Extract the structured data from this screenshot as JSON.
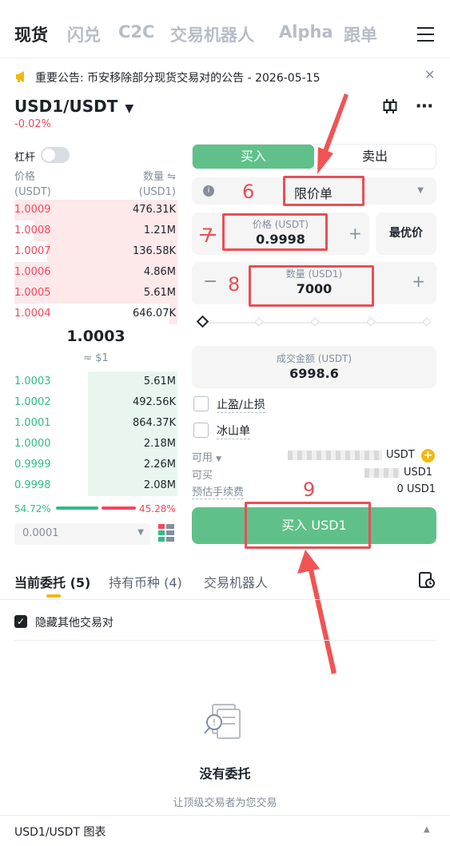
{
  "top_tabs": [
    "现货",
    "闪兑",
    "C2C",
    "交易机器人",
    "Alpha",
    "跟单"
  ],
  "announcement": {
    "text": "重要公告: 币安移除部分现货交易对的公告 - 2026-05-15"
  },
  "pair": {
    "symbol": "USD1/USDT",
    "change": "-0.02%"
  },
  "leverage_label": "杠杆",
  "orderbook": {
    "price_header": "价格",
    "price_unit": "(USDT)",
    "qty_header": "数量",
    "qty_unit": "(USD1)",
    "asks": [
      {
        "price": "1.0009",
        "qty": "476.31K",
        "depth": 1.0
      },
      {
        "price": "1.0008",
        "qty": "1.21M",
        "depth": 0.88
      },
      {
        "price": "1.0007",
        "qty": "136.58K",
        "depth": 0.8
      },
      {
        "price": "1.0006",
        "qty": "4.86M",
        "depth": 1.0
      },
      {
        "price": "1.0005",
        "qty": "5.61M",
        "depth": 1.0
      },
      {
        "price": "1.0004",
        "qty": "646.07K",
        "depth": 0.05
      }
    ],
    "mid_price": "1.0003",
    "mid_fiat": "≈ $1",
    "bids": [
      {
        "price": "1.0003",
        "qty": "5.61M",
        "depth": 0.55
      },
      {
        "price": "1.0002",
        "qty": "492.56K",
        "depth": 0.55
      },
      {
        "price": "1.0001",
        "qty": "864.37K",
        "depth": 0.55
      },
      {
        "price": "1.0000",
        "qty": "2.18M",
        "depth": 0.55
      },
      {
        "price": "0.9999",
        "qty": "2.26M",
        "depth": 0.55
      },
      {
        "price": "0.9998",
        "qty": "2.08M",
        "depth": 0.55
      }
    ],
    "buy_ratio": "54.72%",
    "sell_ratio": "45.28%",
    "buy_ratio_value": 0.5472,
    "precision": "0.0001"
  },
  "form": {
    "buy_tab": "买入",
    "sell_tab": "卖出",
    "order_type": "限价单",
    "price_label": "价格 (USDT)",
    "price_value": "0.9998",
    "best_price": "最优价",
    "qty_label": "数量 (USD1)",
    "qty_value": "7000",
    "total_label": "成交金额 (USDT)",
    "total_value": "6998.6",
    "tp_sl": "止盈/止损",
    "iceberg": "冰山单",
    "available_label": "可用",
    "available_unit": "USDT",
    "can_buy_label": "可买",
    "can_buy_unit": "USD1",
    "fee_label": "预估手续费",
    "fee_value": "0 USD1",
    "submit": "买入 USD1"
  },
  "annotations": [
    "6",
    "7",
    "8",
    "9"
  ],
  "bottom_tabs": {
    "orders": "当前委托",
    "orders_count": "(5)",
    "holdings": "持有币种",
    "holdings_count": "(4)",
    "bots": "交易机器人"
  },
  "hide_other_pairs": "隐藏其他交易对",
  "empty": {
    "title": "没有委托",
    "subtitle": "让顶级交易者为您交易"
  },
  "chart_bar": "USD1/USDT 图表",
  "colors": {
    "red": "#f6465d",
    "green": "#2ebd85",
    "buy_button": "#5fc189",
    "annotation": "#e84f55"
  }
}
